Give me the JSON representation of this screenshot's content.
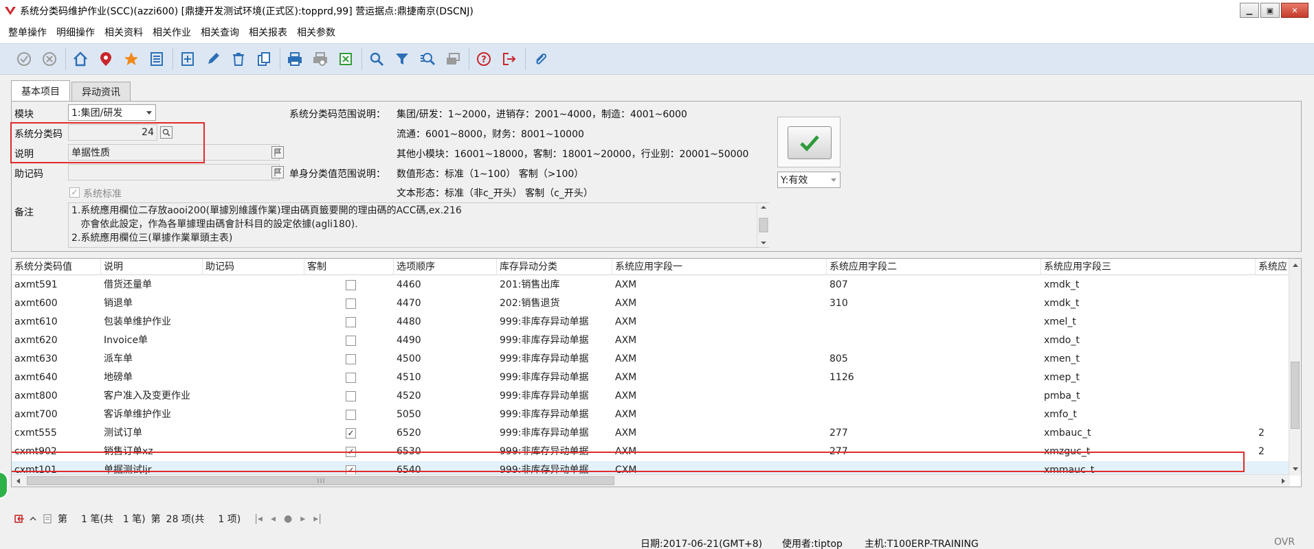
{
  "window": {
    "title": "系统分类码维护作业(SCC)(azzi600)    [鼎捷开发测试环境(正式区):topprd,99]    营运据点:鼎捷南京(DSCNJ)",
    "minimize": "▁",
    "maximize": "▣",
    "close": "✕"
  },
  "menu": [
    "整单操作",
    "明细操作",
    "相关资料",
    "相关作业",
    "相关查询",
    "相关报表",
    "相关参数"
  ],
  "toolbar": {
    "icons": [
      "confirm-icon",
      "cancel-icon",
      "home-icon",
      "location-pin-icon",
      "favorite-star-icon",
      "list-icon",
      "add-icon",
      "edit-icon",
      "delete-icon",
      "copy-icon",
      "print-icon",
      "print-preview-icon",
      "export-excel-icon",
      "search-icon",
      "filter-icon",
      "advanced-search-icon",
      "batch-icon",
      "help-icon",
      "exit-icon",
      "attachment-icon"
    ],
    "colors": {
      "red": "#c8262b",
      "blue": "#2c6fb7",
      "orange": "#f08a1c",
      "gray": "#9a9a9a",
      "green": "#2f9b3a"
    }
  },
  "tabs": [
    "基本项目",
    "异动资讯"
  ],
  "form": {
    "module_label": "模块",
    "module_value": "1:集团/研发",
    "code_label": "系统分类码",
    "code_value": "24",
    "desc_label": "说明",
    "desc_value": "单据性质",
    "mnemonic_label": "助记码",
    "mnemonic_value": "",
    "system_std_label": "系统标准",
    "memo_label": "备注",
    "memo_lines": [
      "1.系统應用欄位二存放aooi200(單據別維護作業)理由碼頁籤要開的理由碼的ACC碼,ex.216",
      "   亦會依此設定，作為各單據理由碼會計科目的設定依據(agli180).",
      "2.系統應用欄位三(單據作業單頭主表)"
    ],
    "range_label": "系统分类码范围说明：",
    "range_lines": [
      "集团/研发：1~2000，进销存：2001~4000，制造：4001~6000",
      "流通：6001~8000，财务：8001~10000",
      "其他小模块：16001~18000，客制：18001~20000，行业别：20001~50000"
    ],
    "single_label": "单身分类值范围说明：",
    "single_lines": [
      "数值形态：标准（1~100）  客制（>100）",
      "文本形态：标准（非c_开头）  客制（c_开头）"
    ],
    "status_value": "Y:有效"
  },
  "grid": {
    "headers": [
      "系统分类码值",
      "说明",
      "助记码",
      "客制",
      "选项顺序",
      "库存异动分类",
      "系统应用字段一",
      "系统应用字段二",
      "系统应用字段三",
      "系统应"
    ],
    "rows": [
      {
        "code": "axmt591",
        "desc": "借货还量单",
        "mnemonic": "",
        "custom": false,
        "seq": "4460",
        "inv": "201:销售出库",
        "f1": "AXM",
        "f2": "807",
        "f3": "xmdk_t",
        "f4": ""
      },
      {
        "code": "axmt600",
        "desc": "销退单",
        "mnemonic": "",
        "custom": false,
        "seq": "4470",
        "inv": "202:销售退货",
        "f1": "AXM",
        "f2": "310",
        "f3": "xmdk_t",
        "f4": ""
      },
      {
        "code": "axmt610",
        "desc": "包装单维护作业",
        "mnemonic": "",
        "custom": false,
        "seq": "4480",
        "inv": "999:非库存异动单据",
        "f1": "AXM",
        "f2": "",
        "f3": "xmel_t",
        "f4": ""
      },
      {
        "code": "axmt620",
        "desc": "Invoice单",
        "mnemonic": "",
        "custom": false,
        "seq": "4490",
        "inv": "999:非库存异动单据",
        "f1": "AXM",
        "f2": "",
        "f3": "xmdo_t",
        "f4": ""
      },
      {
        "code": "axmt630",
        "desc": "派车单",
        "mnemonic": "",
        "custom": false,
        "seq": "4500",
        "inv": "999:非库存异动单据",
        "f1": "AXM",
        "f2": "805",
        "f3": "xmen_t",
        "f4": ""
      },
      {
        "code": "axmt640",
        "desc": "地磅单",
        "mnemonic": "",
        "custom": false,
        "seq": "4510",
        "inv": "999:非库存异动单据",
        "f1": "AXM",
        "f2": "1126",
        "f3": "xmep_t",
        "f4": ""
      },
      {
        "code": "axmt800",
        "desc": "客户准入及变更作业",
        "mnemonic": "",
        "custom": false,
        "seq": "4520",
        "inv": "999:非库存异动单据",
        "f1": "AXM",
        "f2": "",
        "f3": "pmba_t",
        "f4": ""
      },
      {
        "code": "axmt700",
        "desc": "客诉单维护作业",
        "mnemonic": "",
        "custom": false,
        "seq": "5050",
        "inv": "999:非库存异动单据",
        "f1": "AXM",
        "f2": "",
        "f3": "xmfo_t",
        "f4": ""
      },
      {
        "code": "cxmt555",
        "desc": "测试订单",
        "mnemonic": "",
        "custom": true,
        "seq": "6520",
        "inv": "999:非库存异动单据",
        "f1": "AXM",
        "f2": "277",
        "f3": "xmbauc_t",
        "f4": "2"
      },
      {
        "code": "cxmt902",
        "desc": "销售订单xz",
        "mnemonic": "",
        "custom": true,
        "seq": "6530",
        "inv": "999:非库存异动单据",
        "f1": "AXM",
        "f2": "277",
        "f3": "xmzguc_t",
        "f4": "2"
      },
      {
        "code": "cxmt101",
        "desc": "单据测试ljr",
        "mnemonic": "",
        "custom": true,
        "seq": "6540",
        "inv": "999:非库存异动单据",
        "f1": "CXM",
        "f2": "",
        "f3": "xmmauc_t",
        "f4": ""
      }
    ],
    "selected_index": 10,
    "vscroll_fraction": 0.72,
    "hscroll_fraction": 0.47
  },
  "pager": {
    "prefix": "第",
    "record": "1 笔(共",
    "record_total": "1 笔)",
    "item_prefix": "第",
    "item": "28 项(共",
    "item_total": "1 项)"
  },
  "status": {
    "date": "日期:2017-06-21(GMT+8)",
    "user": "使用者:tiptop",
    "host": "主机:T100ERP-TRAINING",
    "mode": "OVR"
  }
}
